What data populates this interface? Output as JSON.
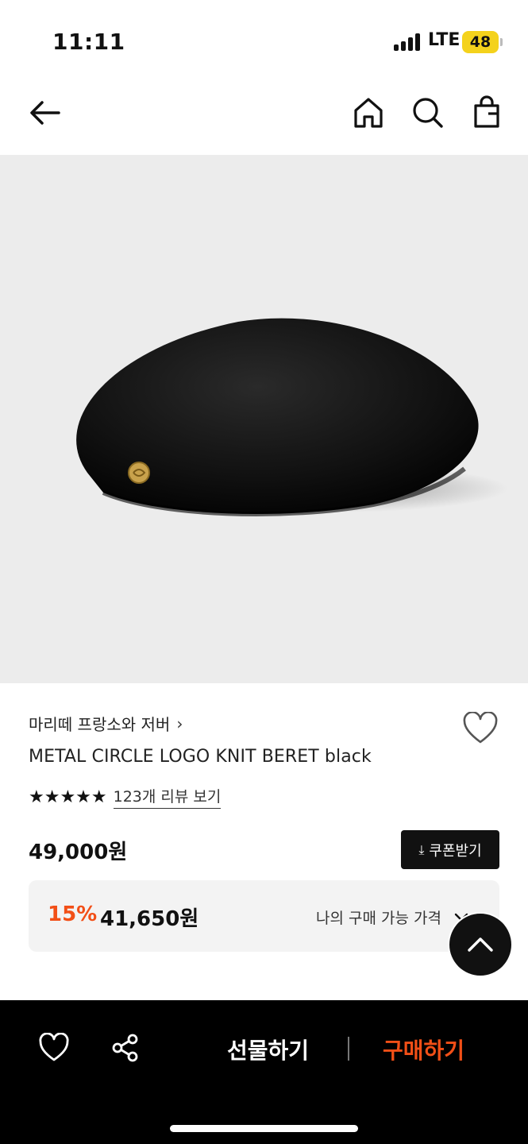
{
  "status_bar": {
    "time": "11:11",
    "network": "LTE",
    "battery": "48"
  },
  "nav": {
    "back_icon": "arrow-left-icon",
    "home_icon": "home-icon",
    "search_icon": "search-icon",
    "bag_icon": "shopping-bag-icon"
  },
  "product": {
    "brand": "마리떼 프랑소와 저버",
    "brand_chevron": "›",
    "name": "METAL CIRCLE LOGO KNIT BERET black",
    "stars": "★★★★★",
    "review_link": "123개 리뷰 보기",
    "price": "49,000원",
    "coupon_button": "쿠폰받기",
    "discount": {
      "rate": "15%",
      "price": "41,650원",
      "label": "나의 구매 가능 가격"
    }
  },
  "bottom_bar": {
    "gift_button": "선물하기",
    "buy_button": "구매하기"
  },
  "colors": {
    "accent": "#f24f17",
    "dark": "#111111",
    "image_bg": "#ececec",
    "discount_bg": "#f3f3f3",
    "battery": "#f4d21c"
  }
}
